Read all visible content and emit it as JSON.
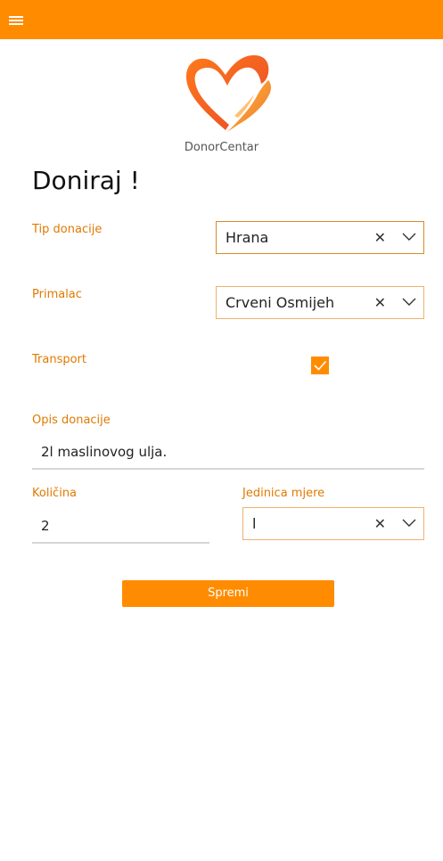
{
  "header": {
    "menu_icon": "hamburger-icon"
  },
  "brand": {
    "logo_icon": "heart-hand-icon",
    "name": "DonorCentar"
  },
  "form": {
    "title": "Doniraj !",
    "tip_donacije": {
      "label": "Tip donacije",
      "value": "Hrana",
      "clear": "✕"
    },
    "primalac": {
      "label": "Primalac",
      "value": "Crveni Osmijeh",
      "clear": "✕"
    },
    "transport": {
      "label": "Transport",
      "checked": true
    },
    "opis": {
      "label": "Opis donacije",
      "value": "2l maslinovog ulja."
    },
    "kolicina": {
      "label": "Količina",
      "value": "2"
    },
    "jedinica": {
      "label": "Jedinica mjere",
      "value": "l",
      "clear": "✕"
    },
    "submit_label": "Spremi"
  },
  "colors": {
    "accent": "#ff8c00",
    "label": "#e07a00"
  }
}
